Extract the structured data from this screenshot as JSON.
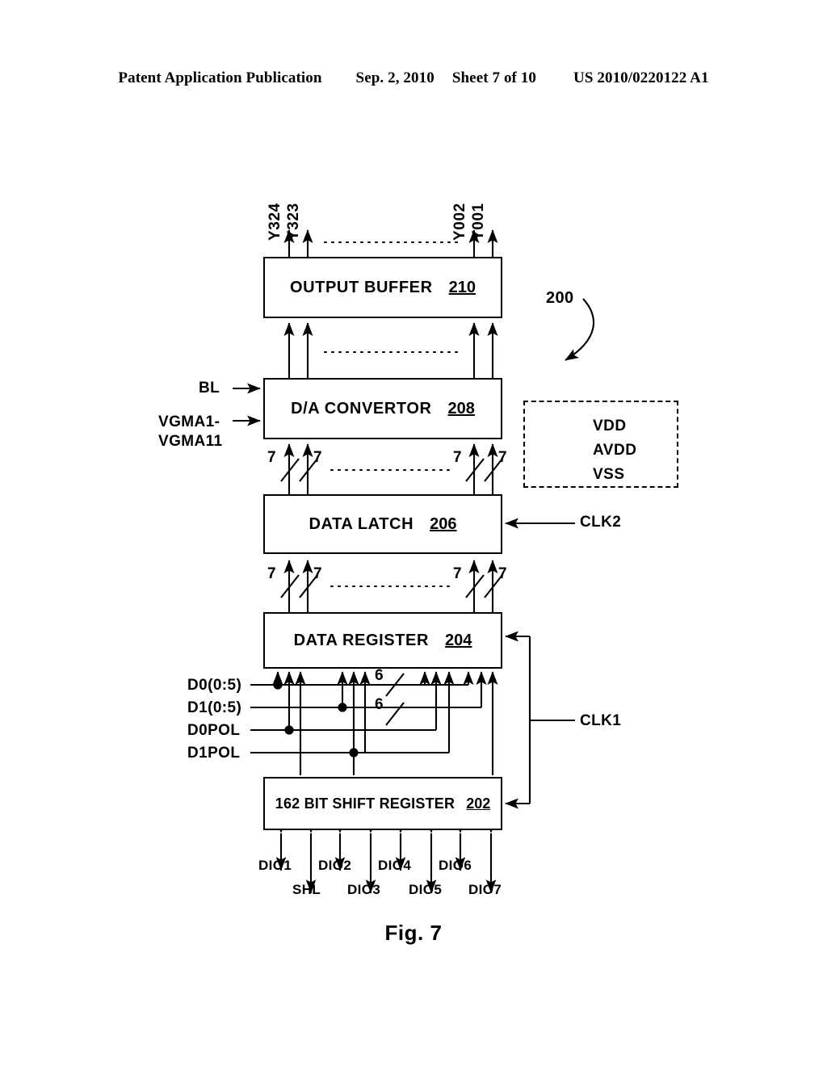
{
  "header": {
    "publication": "Patent Application Publication",
    "date": "Sep. 2, 2010",
    "sheet": "Sheet 7 of 10",
    "number": "US 2010/0220122 A1"
  },
  "figure": {
    "caption": "Fig. 7",
    "system_ref": "200"
  },
  "blocks": [
    {
      "id": "output-buffer",
      "label": "OUTPUT BUFFER",
      "ref": "210"
    },
    {
      "id": "dac",
      "label": "D/A CONVERTOR",
      "ref": "208"
    },
    {
      "id": "data-latch",
      "label": "DATA LATCH",
      "ref": "206"
    },
    {
      "id": "data-register",
      "label": "DATA REGISTER",
      "ref": "204"
    },
    {
      "id": "shift-register",
      "label": "162 BIT SHIFT REGISTER",
      "ref": "202"
    }
  ],
  "outputs": {
    "left": [
      "Y324",
      "Y323"
    ],
    "right": [
      "Y002",
      "Y001"
    ]
  },
  "dac_inputs": {
    "bl": "BL",
    "vgma_line1": "VGMA1-",
    "vgma_line2": "VGMA11"
  },
  "power_box": {
    "rails": [
      "VDD",
      "AVDD",
      "VSS"
    ]
  },
  "clocks": {
    "clk2": "CLK2",
    "clk1": "CLK1"
  },
  "data_inputs": [
    {
      "name": "D0(0:5)"
    },
    {
      "name": "D1(0:5)"
    },
    {
      "name": "D0POL"
    },
    {
      "name": "D1POL"
    }
  ],
  "bus_widths": {
    "dac_to_latch": "7",
    "latch_to_register": "7",
    "data_in": "6"
  },
  "dio": {
    "upper_row": [
      "DIO1",
      "DIO2",
      "DIO4",
      "DIO6"
    ],
    "lower_row": [
      "SHL",
      "DIO3",
      "DIO5",
      "DIO7"
    ]
  },
  "colors": {
    "ink": "#000000",
    "paper": "#ffffff"
  }
}
